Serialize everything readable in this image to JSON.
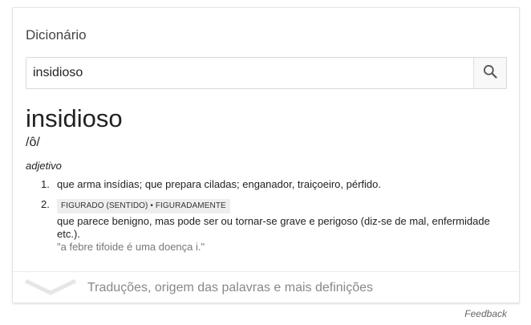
{
  "card": {
    "title": "Dicionário",
    "search": {
      "value": "insidioso",
      "placeholder": ""
    }
  },
  "entry": {
    "word": "insidioso",
    "phonetic": "/ô/",
    "part_of_speech": "adjetivo",
    "definitions": [
      {
        "number": "1.",
        "text": "que arma insídias; que prepara ciladas; enganador, traiçoeiro, pérfido."
      },
      {
        "number": "2.",
        "tag": "FIGURADO (SENTIDO) • FIGURADAMENTE",
        "text": "que parece benigno, mas pode ser ou tornar-se grave e perigoso (diz-se de mal, enfermidade etc.).",
        "example": "\"a febre tifoide é uma doença i.\""
      }
    ]
  },
  "footer": {
    "more_label": "Traduções, origem das palavras e mais definições"
  },
  "feedback_label": "Feedback",
  "icons": {
    "search": "search-icon",
    "expand": "chevron-down-icon"
  },
  "colors": {
    "search_icon": "#555555",
    "chevron": "#e6e6e6",
    "muted_text": "#888888"
  }
}
